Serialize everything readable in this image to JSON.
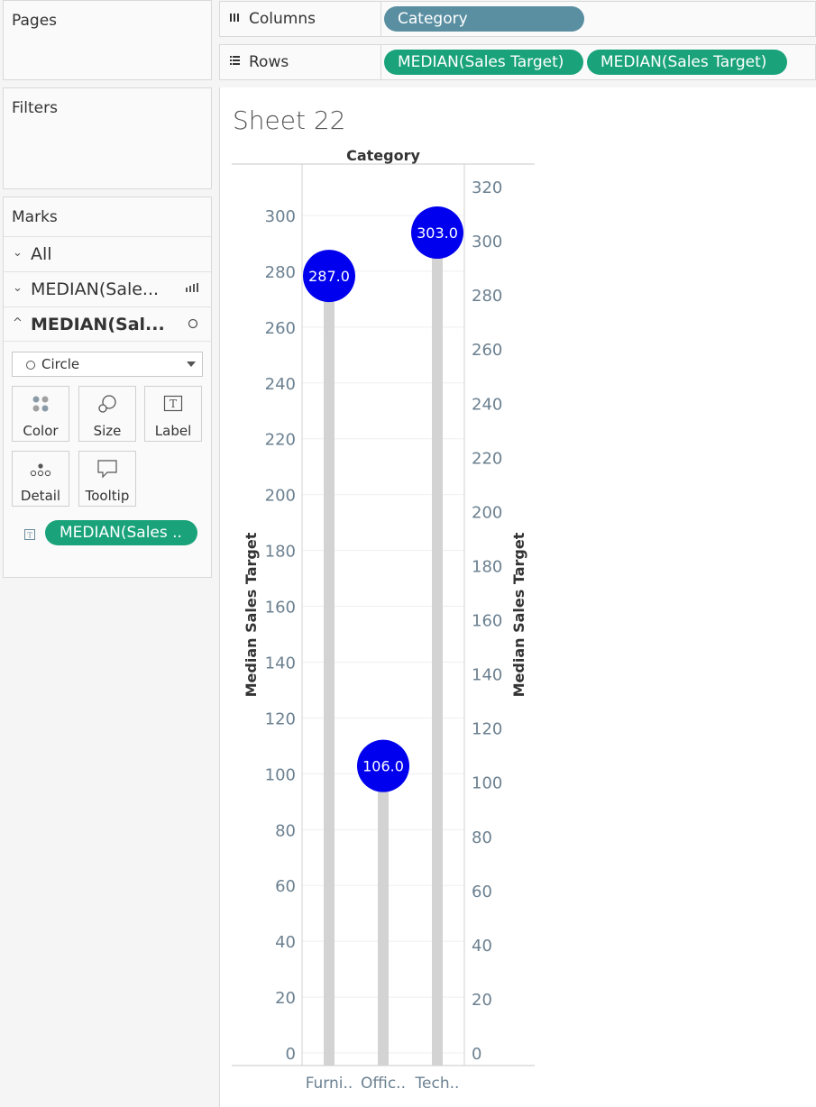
{
  "pages": {
    "title": "Pages"
  },
  "filters": {
    "title": "Filters"
  },
  "marks": {
    "title": "Marks",
    "rows": [
      {
        "label": "All",
        "chev": "⌄"
      },
      {
        "label": "MEDIAN(Sale...",
        "chev": "⌄"
      },
      {
        "label": "MEDIAN(Sal...",
        "chev": "^"
      }
    ],
    "mark_type": "Circle",
    "cards": {
      "color": "Color",
      "size": "Size",
      "label": "Label",
      "detail": "Detail",
      "tooltip": "Tooltip"
    },
    "label_pill": "MEDIAN(Sales .."
  },
  "shelves": {
    "columns_label": "Columns",
    "columns_pill": "Category",
    "rows_label": "Rows",
    "rows_pills": [
      "MEDIAN(Sales Target)",
      "MEDIAN(Sales Target)"
    ]
  },
  "sheet_title": "Sheet 22",
  "chart_data": {
    "type": "lollipop",
    "header": "Category",
    "categories": [
      "Furni..",
      "Offic..",
      "Tech.."
    ],
    "values": [
      287.0,
      106.0,
      303.0
    ],
    "data_labels": [
      "287.0",
      "106.0",
      "303.0"
    ],
    "left_axis": {
      "label": "Median Sales Target",
      "range": [
        0,
        300
      ],
      "ticks": [
        0,
        20,
        40,
        60,
        80,
        100,
        120,
        140,
        160,
        180,
        200,
        220,
        240,
        260,
        280,
        300
      ]
    },
    "right_axis": {
      "label": "Median Sales Target",
      "range": [
        0,
        320
      ],
      "ticks": [
        0,
        20,
        40,
        60,
        80,
        100,
        120,
        140,
        160,
        180,
        200,
        220,
        240,
        260,
        280,
        300,
        320
      ]
    },
    "colors": {
      "bar": "#d3d3d3",
      "circle": "#0000ee",
      "axis_text": "#6b8090"
    }
  }
}
